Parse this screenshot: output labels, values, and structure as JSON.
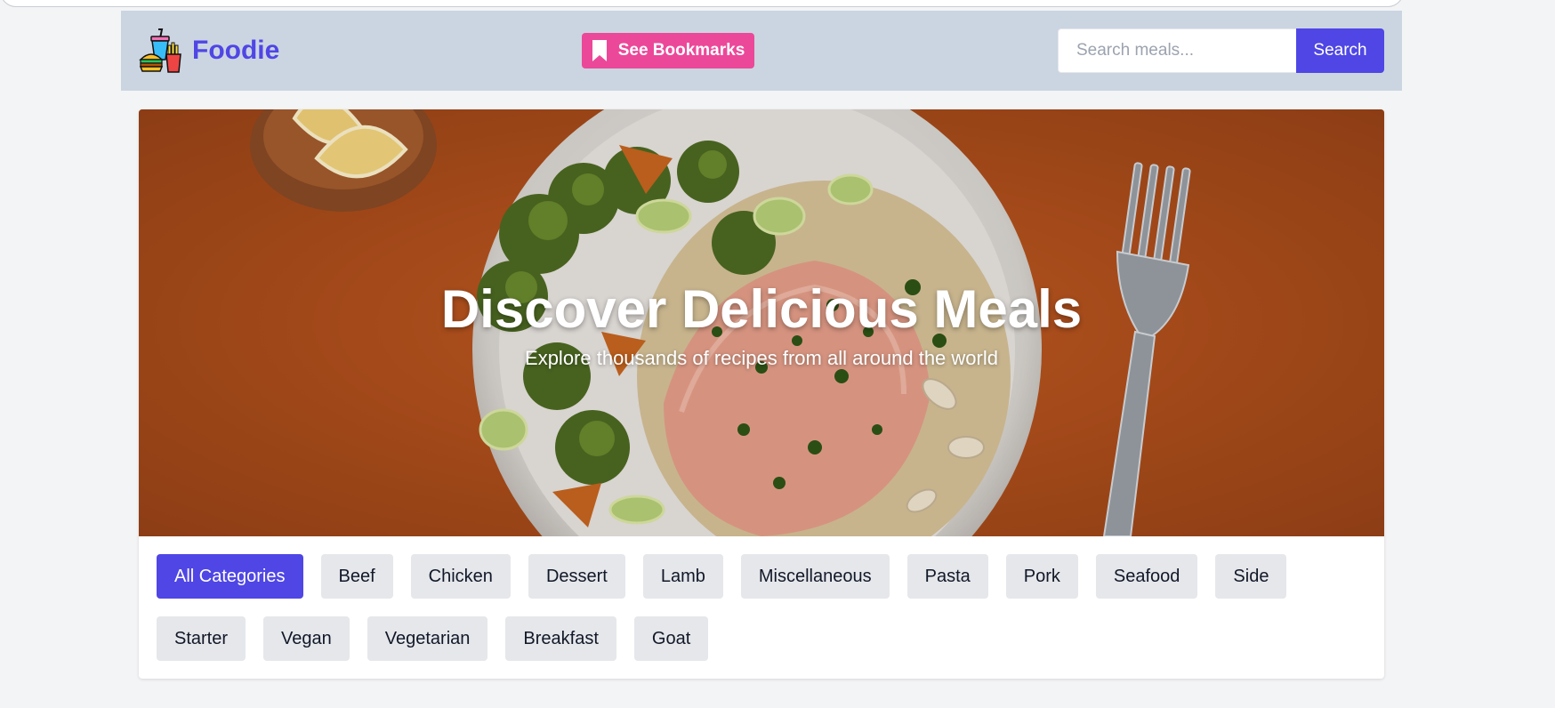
{
  "header": {
    "logo_text": "Foodie",
    "bookmarks_label": "See Bookmarks",
    "search": {
      "placeholder": "Search meals...",
      "value": "",
      "button_label": "Search"
    }
  },
  "hero": {
    "title": "Discover Delicious Meals",
    "subtitle": "Explore thousands of recipes from all around the world"
  },
  "categories": {
    "active_index": 0,
    "items": [
      "All Categories",
      "Beef",
      "Chicken",
      "Dessert",
      "Lamb",
      "Miscellaneous",
      "Pasta",
      "Pork",
      "Seafood",
      "Side",
      "Starter",
      "Vegan",
      "Vegetarian",
      "Breakfast",
      "Goat"
    ]
  },
  "colors": {
    "brand": "#4f46e5",
    "bookmarks": "#ec4899",
    "header_bg": "#cbd5e1",
    "chip_bg": "#e5e7eb",
    "hero_bg": "#b4521d"
  },
  "icons": {
    "logo": "fast-food-icon",
    "bookmark": "bookmark-icon"
  }
}
